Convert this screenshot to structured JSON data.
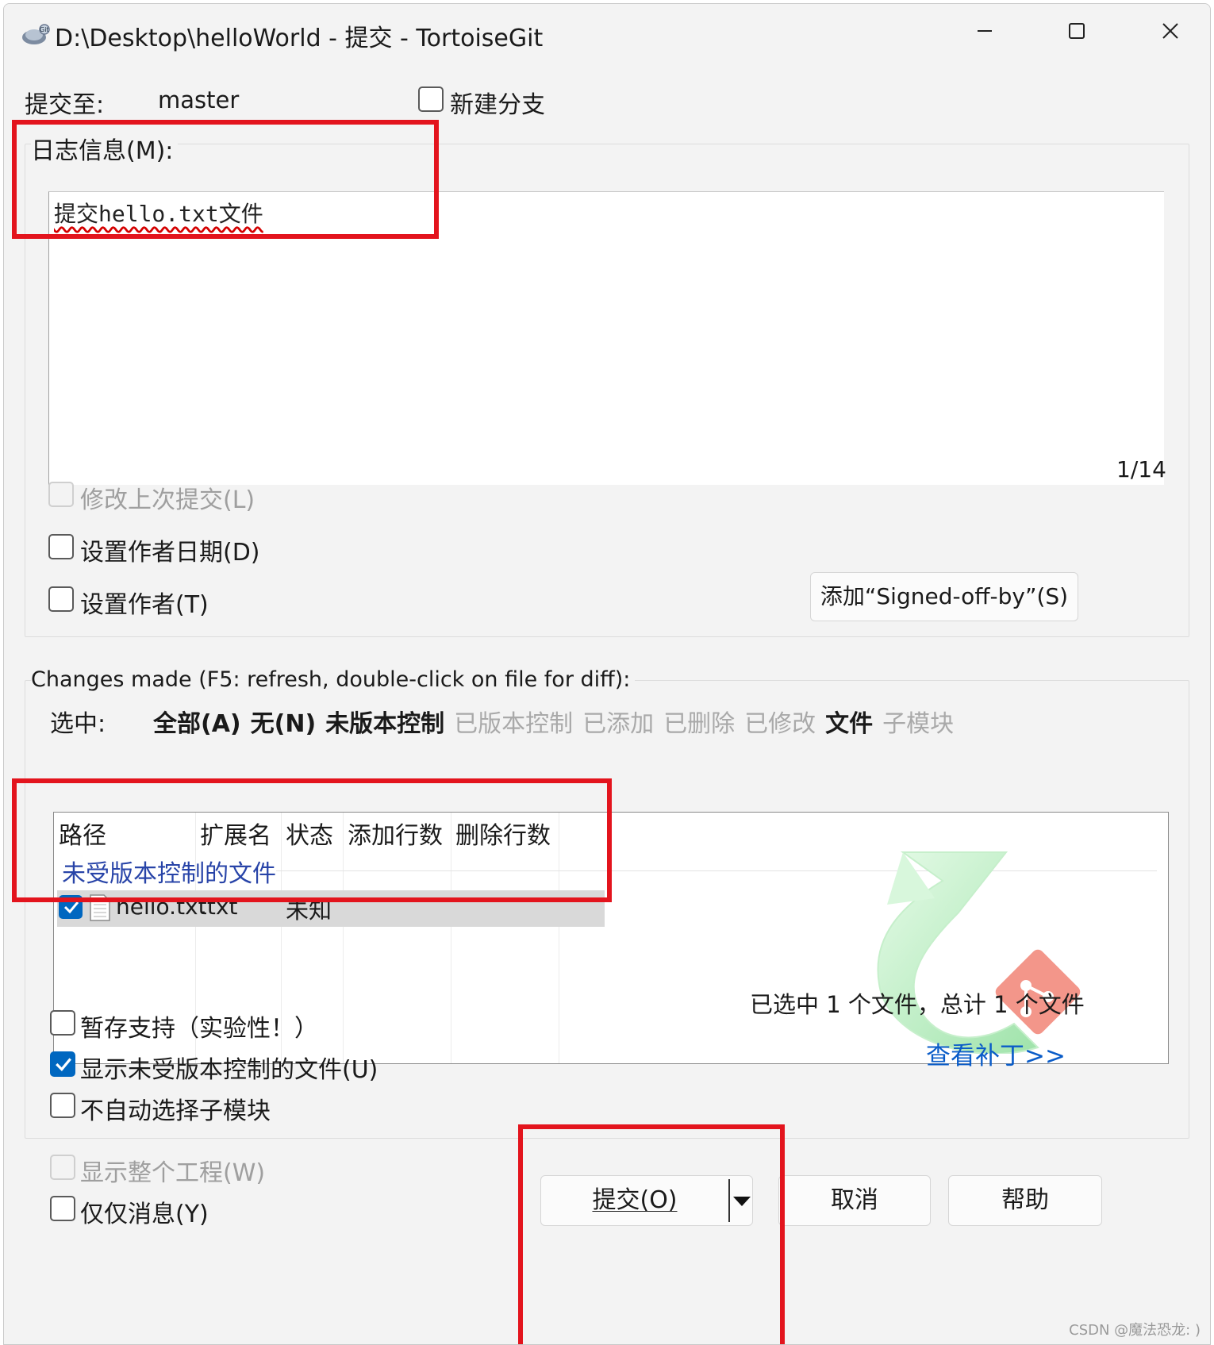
{
  "window": {
    "title": "D:\\Desktop\\helloWorld - 提交 - TortoiseGit",
    "minimize_icon": "minimize-icon",
    "maximize_icon": "maximize-icon",
    "close_icon": "close-icon"
  },
  "commit_to": {
    "label": "提交至:",
    "branch": "master",
    "new_branch_label": "新建分支",
    "new_branch_checked": false
  },
  "message": {
    "group_label": "日志信息(M):",
    "text": "提交hello.txt文件",
    "position": "1/14"
  },
  "options": {
    "amend_label": "修改上次提交(L)",
    "amend_disabled": true,
    "author_date_label": "设置作者日期(D)",
    "author_label": "设置作者(T)",
    "signoff_button": "添加“Signed-off-by”(S)"
  },
  "changes": {
    "group_label": "Changes made (F5: refresh, double-click on file for diff):",
    "select_label": "选中:",
    "filters": [
      {
        "label": "全部(A)",
        "active": true
      },
      {
        "label": "无(N)",
        "active": true
      },
      {
        "label": "未版本控制",
        "active": true
      },
      {
        "label": "已版本控制",
        "active": false
      },
      {
        "label": "已添加",
        "active": false
      },
      {
        "label": "已删除",
        "active": false
      },
      {
        "label": "已修改",
        "active": false
      },
      {
        "label": "文件",
        "active": true
      },
      {
        "label": "子模块",
        "active": false
      }
    ],
    "columns": [
      "路径",
      "扩展名",
      "状态",
      "添加行数",
      "删除行数"
    ],
    "group_header": "未受版本控制的文件",
    "files": [
      {
        "checked": true,
        "icon": "text-file-icon",
        "path": "hello.txt",
        "ext": ".txt",
        "status": "未知",
        "added": "",
        "deleted": ""
      }
    ],
    "summary": "已选中 1 个文件，总计 1 个文件",
    "view_patch": "查看补丁>>",
    "stash_label": "暂存支持（实验性！）",
    "show_unversioned_label": "显示未受版本控制的文件(U)",
    "show_unversioned_checked": true,
    "no_autoselect_submodules_label": "不自动选择子模块"
  },
  "footer": {
    "whole_project_label": "显示整个工程(W)",
    "whole_project_disabled": true,
    "message_only_label": "仅仅消息(Y)",
    "commit_button": "提交(O)",
    "cancel_button": "取消",
    "help_button": "帮助"
  },
  "watermark": "CSDN @魔法恐龙: )",
  "colors": {
    "accent": "#0067c0",
    "highlight_box": "#e3141d",
    "group_header": "#2844a8",
    "link": "#0a5cc8"
  }
}
